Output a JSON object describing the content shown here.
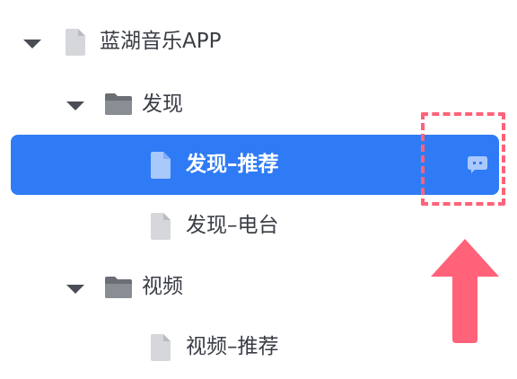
{
  "tree": {
    "items": [
      {
        "label": "蓝湖音乐APP",
        "type": "file",
        "expanded": true
      },
      {
        "label": "发现",
        "type": "folder",
        "expanded": true
      },
      {
        "label": "发现–推荐",
        "type": "file",
        "selected": true
      },
      {
        "label": "发现–电台",
        "type": "file"
      },
      {
        "label": "视频",
        "type": "folder",
        "expanded": true
      },
      {
        "label": "视频–推荐",
        "type": "file"
      }
    ]
  },
  "icons": {
    "caret": "caret-down-icon",
    "file": "file-icon",
    "folder": "folder-icon",
    "comment": "comment-icon"
  },
  "colors": {
    "selected_bg": "#2f7bf5",
    "annotation": "#ff6279",
    "text": "#3a3d45",
    "icon_gray": "#d5d7db",
    "folder_gray": "#6b6e75"
  }
}
